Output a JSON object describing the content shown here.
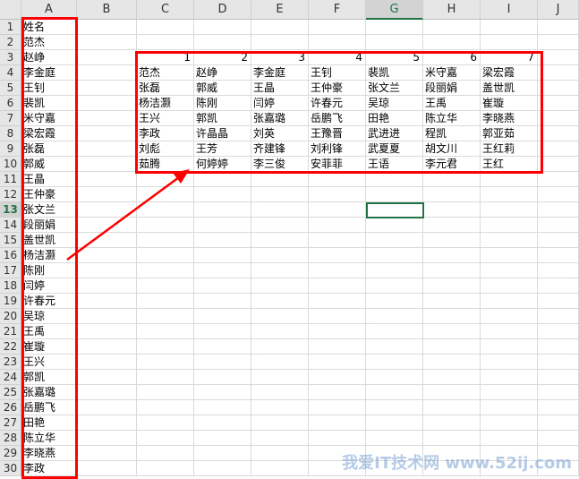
{
  "columns": [
    "A",
    "B",
    "C",
    "D",
    "E",
    "F",
    "G",
    "H",
    "I",
    "J"
  ],
  "selected_cell": "G13",
  "column_a": [
    "姓名",
    "范杰",
    "赵峥",
    "李金庭",
    "王钊",
    "裴凯",
    "米守嘉",
    "梁宏霞",
    "张磊",
    "郭威",
    "王晶",
    "王仲豪",
    "张文兰",
    "段丽娟",
    "盖世凯",
    "杨洁灏",
    "陈刚",
    "闫婷",
    "许春元",
    "吴琼",
    "王禹",
    "崔璇",
    "王兴",
    "郭凯",
    "张嘉璐",
    "岳鹏飞",
    "田艳",
    "陈立华",
    "李晓燕",
    "李政"
  ],
  "table_headers": [
    "1",
    "2",
    "3",
    "4",
    "5",
    "6",
    "7"
  ],
  "table_rows": [
    [
      "范杰",
      "赵峥",
      "李金庭",
      "王钊",
      "裴凯",
      "米守嘉",
      "梁宏霞"
    ],
    [
      "张磊",
      "郭威",
      "王晶",
      "王仲豪",
      "张文兰",
      "段丽娟",
      "盖世凯"
    ],
    [
      "杨洁灏",
      "陈刚",
      "闫婷",
      "许春元",
      "吴琼",
      "王禹",
      "崔璇"
    ],
    [
      "王兴",
      "郭凯",
      "张嘉璐",
      "岳鹏飞",
      "田艳",
      "陈立华",
      "李晓燕"
    ],
    [
      "李政",
      "许晶晶",
      "刘英",
      "王豫晋",
      "武进进",
      "程凯",
      "郭亚茹"
    ],
    [
      "刘彪",
      "王芳",
      "齐建锋",
      "刘利锋",
      "武夏夏",
      "胡文川",
      "王红莉"
    ],
    [
      "茹腾",
      "何婷婷",
      "李三俊",
      "安菲菲",
      "王语",
      "李元君",
      "王红"
    ]
  ],
  "watermark": "我爱IT技术网 www.52ij.com",
  "colors": {
    "highlight": "#ff0000",
    "selection": "#217346"
  }
}
